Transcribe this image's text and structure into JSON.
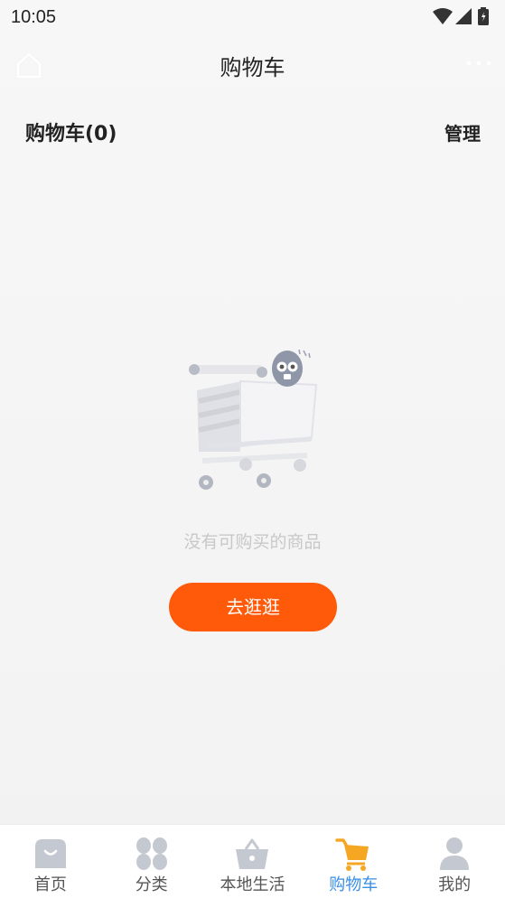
{
  "status_bar": {
    "time": "10:05",
    "icons": [
      "wifi-icon",
      "cell-signal-icon",
      "battery-icon"
    ]
  },
  "nav": {
    "title": "购物车",
    "home_icon": "home-icon",
    "more_icon": "more-dots-icon"
  },
  "cart": {
    "count_label": "购物车(0)",
    "manage_label": "管理"
  },
  "empty": {
    "illustration": "empty-cart-illustration",
    "message": "没有可购买的商品",
    "button_label": "去逛逛"
  },
  "tab_bar": {
    "active_color": "#3a8ee6",
    "items": [
      {
        "label": "首页",
        "icon": "home-bag-icon"
      },
      {
        "label": "分类",
        "icon": "category-icon"
      },
      {
        "label": "本地生活",
        "icon": "basket-icon"
      },
      {
        "label": "购物车",
        "icon": "cart-icon",
        "active": true
      },
      {
        "label": "我的",
        "icon": "profile-icon"
      }
    ]
  },
  "colors": {
    "accent": "#ff5a0a",
    "active_tab": "#3a8ee6",
    "cart_icon": "#f5a623"
  }
}
